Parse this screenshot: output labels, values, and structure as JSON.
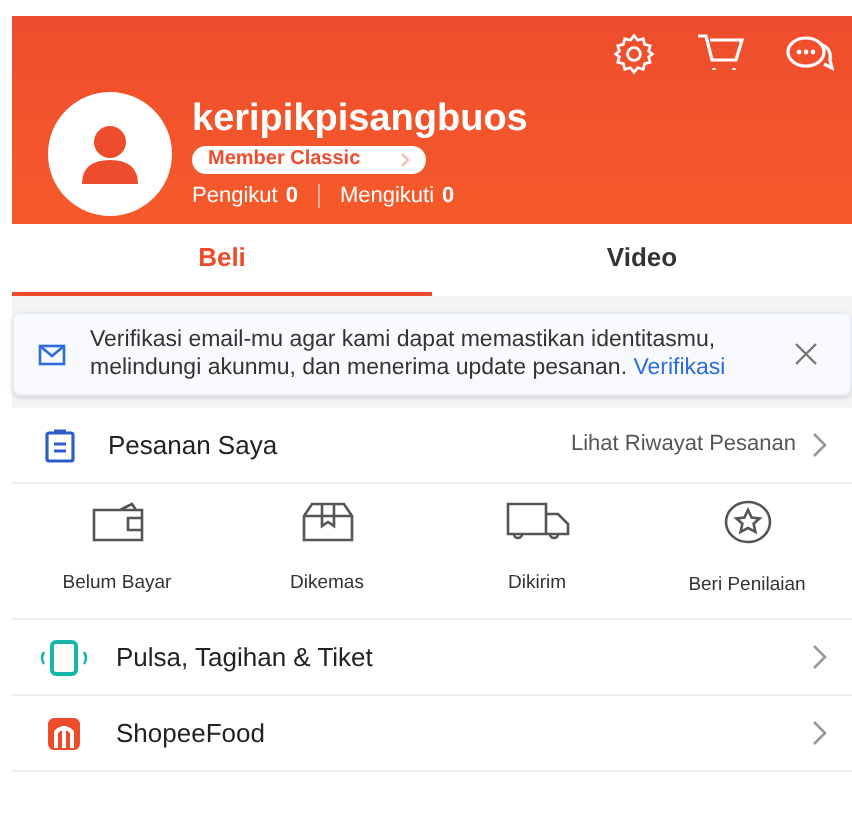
{
  "profile": {
    "username": "keripikpisangbuos",
    "member_badge": "Member Classic",
    "followers_label": "Pengikut",
    "followers": "0",
    "following_label": "Mengikuti",
    "following": "0"
  },
  "tabs": [
    {
      "label": "Beli",
      "selected": true
    },
    {
      "label": "Video",
      "selected": false
    }
  ],
  "notice": {
    "text": "Verifikasi email-mu agar kami dapat memastikan identitasmu, melindungi akunmu, dan menerima update pesanan.",
    "link": "Verifikasi"
  },
  "orders": {
    "title": "Pesanan Saya",
    "link": "Lihat Riwayat Pesanan",
    "statuses": [
      {
        "kind": "wallet",
        "label": "Belum Bayar"
      },
      {
        "kind": "box",
        "label": "Dikemas"
      },
      {
        "kind": "truck",
        "label": "Dikirim"
      },
      {
        "kind": "star",
        "label": "Beri Penilaian"
      }
    ]
  },
  "menu": [
    {
      "kind": "phone",
      "label": "Pulsa, Tagihan & Tiket"
    },
    {
      "kind": "food",
      "label": "ShopeeFood"
    }
  ]
}
